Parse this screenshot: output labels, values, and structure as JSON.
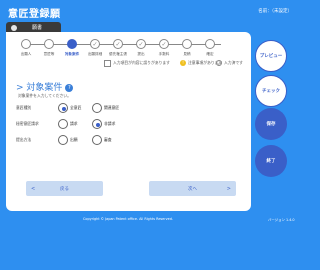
{
  "app": {
    "title": "意匠登録願",
    "user": "名前：（未設定）"
  },
  "tab": {
    "label": "願書"
  },
  "steps": [
    {
      "label": "出願人",
      "state": "pending"
    },
    {
      "label": "意匠等",
      "state": "pending"
    },
    {
      "label": "対象案件",
      "state": "current"
    },
    {
      "label": "出願詳細",
      "state": "done"
    },
    {
      "label": "優先権主張",
      "state": "done"
    },
    {
      "label": "提出",
      "state": "done"
    },
    {
      "label": "手数料",
      "state": "done"
    },
    {
      "label": "見積",
      "state": "pending"
    },
    {
      "label": "確定",
      "state": "pending"
    }
  ],
  "legend": {
    "unentered": "入力項目が内容に誤りがあります",
    "warning": "注意事項があります",
    "complete": "入力済です"
  },
  "section": {
    "title": "> 対象案件",
    "help_icon": "?",
    "subtitle": "対象案件を入力してください。"
  },
  "form": {
    "rows": [
      {
        "label": "意匠種別",
        "options": [
          {
            "label": "全意匠",
            "checked": true
          },
          {
            "label": "関連意匠",
            "checked": false
          }
        ]
      },
      {
        "label": "秘密意匠請求",
        "options": [
          {
            "label": "請求",
            "checked": false
          },
          {
            "label": "非請求",
            "checked": true
          }
        ]
      },
      {
        "label": "提出方法",
        "options": [
          {
            "label": "出願",
            "checked": false
          },
          {
            "label": "審査",
            "checked": false
          }
        ]
      }
    ]
  },
  "nav": {
    "back_label": "戻る",
    "next_label": "次へ",
    "back_arrow": "<",
    "next_arrow": ">"
  },
  "side_buttons": {
    "preview": "プレビュー",
    "check": "チェック",
    "save": "保存",
    "finish": "終了"
  },
  "footer": {
    "copyright": "Copyright © Japan Patent office. All Rights Reserved.",
    "version": "バージョン 1.4.0"
  },
  "colors": {
    "background": "#2e8ff0",
    "accent": "#3a5fc8",
    "warning": "#f0c020"
  }
}
